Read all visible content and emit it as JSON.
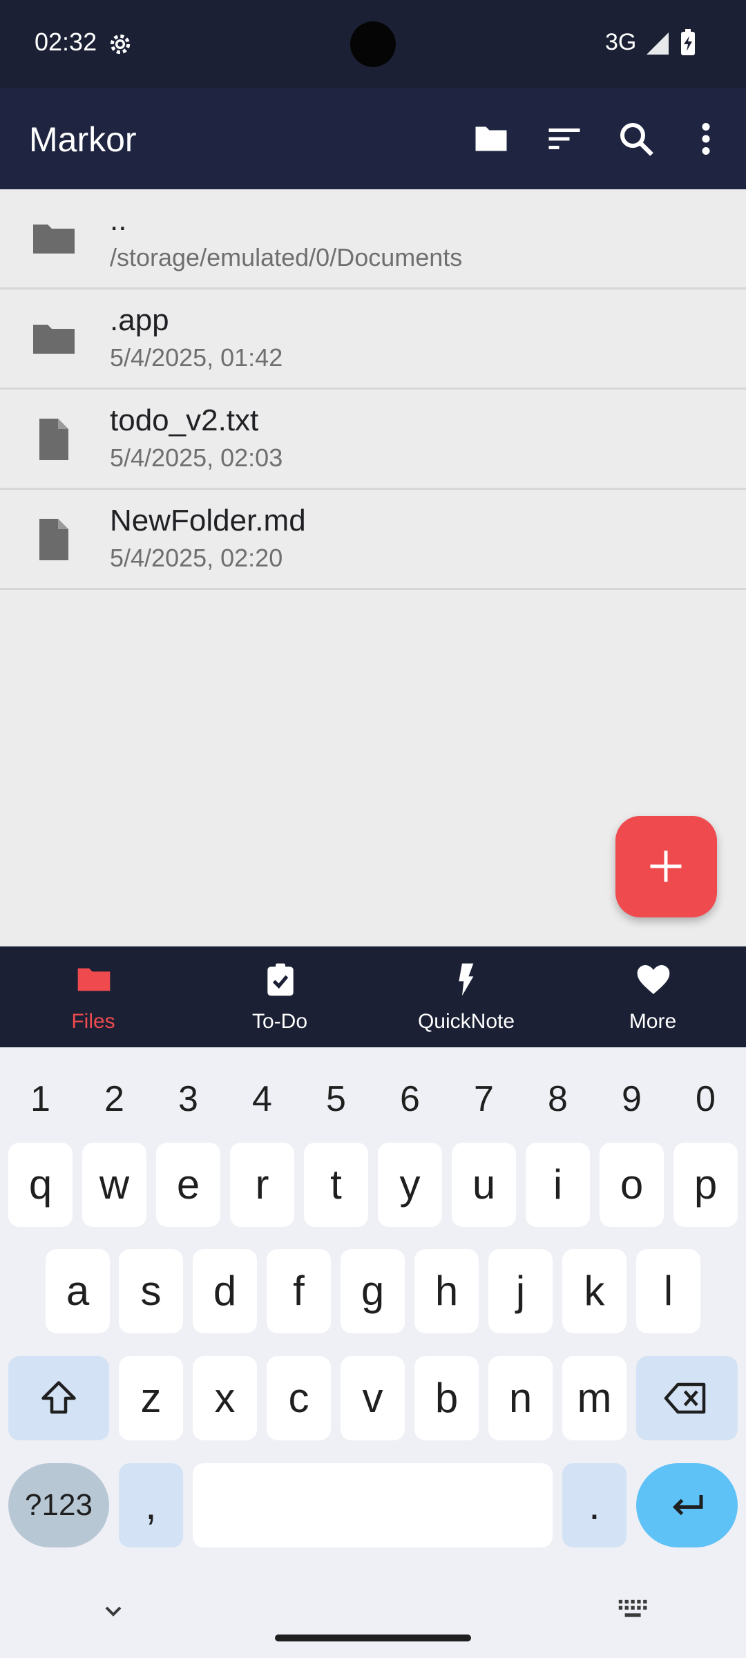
{
  "status_bar": {
    "time": "02:32",
    "network": "3G"
  },
  "app_bar": {
    "title": "Markor"
  },
  "files": [
    {
      "name": "..",
      "meta": "/storage/emulated/0/Documents",
      "type": "folder"
    },
    {
      "name": ".app",
      "meta": "5/4/2025, 01:42",
      "type": "folder"
    },
    {
      "name": "todo_v2.txt",
      "meta": "5/4/2025, 02:03",
      "type": "file"
    },
    {
      "name": "NewFolder.md",
      "meta": "5/4/2025, 02:20",
      "type": "file"
    }
  ],
  "bottom_nav": [
    {
      "label": "Files",
      "active": true
    },
    {
      "label": "To-Do"
    },
    {
      "label": "QuickNote"
    },
    {
      "label": "More"
    }
  ],
  "keyboard": {
    "numbers": [
      "1",
      "2",
      "3",
      "4",
      "5",
      "6",
      "7",
      "8",
      "9",
      "0"
    ],
    "row1": [
      "q",
      "w",
      "e",
      "r",
      "t",
      "y",
      "u",
      "i",
      "o",
      "p"
    ],
    "row2": [
      "a",
      "s",
      "d",
      "f",
      "g",
      "h",
      "j",
      "k",
      "l"
    ],
    "row3": [
      "z",
      "x",
      "c",
      "v",
      "b",
      "n",
      "m"
    ],
    "sym_label": "?123",
    "comma": ",",
    "period": "."
  },
  "colors": {
    "app_bar": "#1f2541",
    "status_bar": "#1b2035",
    "accent": "#ef4a4d",
    "enter_key": "#5ec2f7"
  }
}
